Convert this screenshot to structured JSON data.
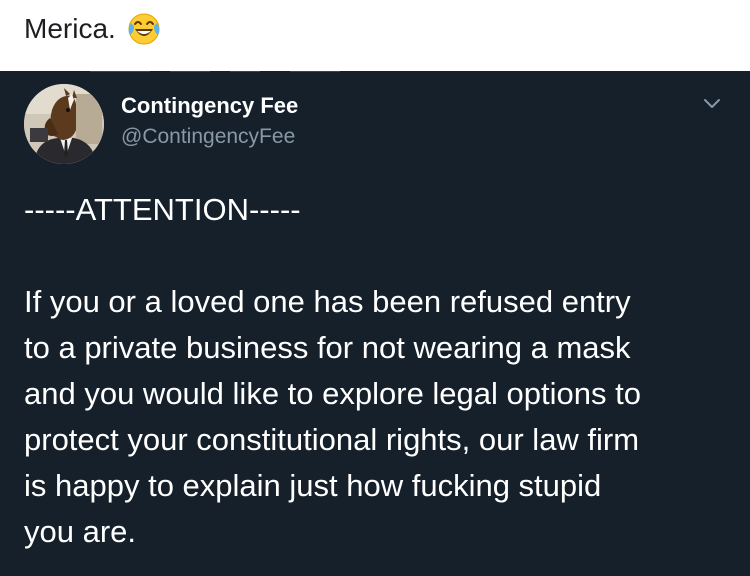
{
  "post": {
    "caption": "Merica.",
    "caption_emoji": "laughing-crying-face-icon"
  },
  "tweet": {
    "display_name": "Contingency Fee",
    "handle": "@ContingencyFee",
    "menu_icon": "chevron-down-icon",
    "attention_line": "-----ATTENTION-----",
    "body_lines": [
      "If you or a loved one has been refused entry",
      "to a private business for not wearing a mask",
      "and you would like to explore legal options to",
      "protect your constitutional rights, our law firm",
      "is happy to explain just how fucking stupid",
      "you are."
    ],
    "colors": {
      "background": "#15202b",
      "text": "#ffffff",
      "secondary_text": "#8899a6"
    }
  }
}
